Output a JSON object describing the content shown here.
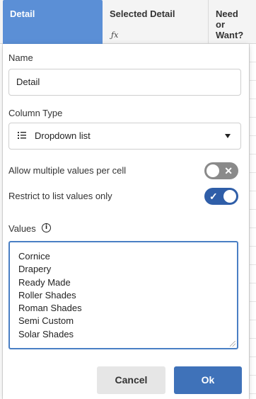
{
  "columns": {
    "detail": "Detail",
    "selected_detail": "Selected Detail",
    "need_or_want": "Need or Want?",
    "formula_icon": "fx-icon"
  },
  "panel": {
    "name_label": "Name",
    "name_value": "Detail",
    "column_type_label": "Column Type",
    "column_type_value": "Dropdown list",
    "allow_multiple_label": "Allow multiple values per cell",
    "allow_multiple_on": false,
    "restrict_label": "Restrict to list values only",
    "restrict_on": true,
    "values_label": "Values",
    "values": [
      "Cornice",
      "Drapery",
      "Ready Made",
      "Roller Shades",
      "Roman Shades",
      "Semi Custom",
      "Solar Shades"
    ],
    "cancel_label": "Cancel",
    "ok_label": "Ok"
  },
  "colors": {
    "active_header": "#5b8fd6",
    "toggle_on": "#2f5ea8",
    "toggle_off": "#8a8a8a",
    "ok_button": "#3f72b9",
    "focus_border": "#4a7fc4"
  }
}
